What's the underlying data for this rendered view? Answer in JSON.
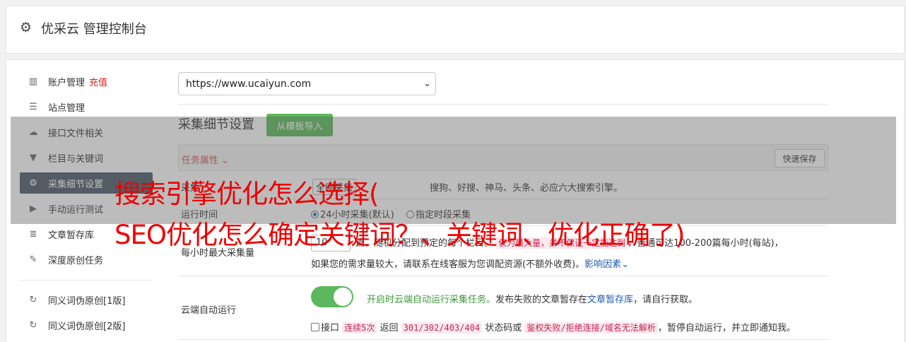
{
  "app": {
    "title": "优采云 管理控制台",
    "icon": "gear-icon"
  },
  "sidebar": {
    "items": [
      {
        "label": "账户管理",
        "extra": "充值",
        "icon": "bar-chart-icon",
        "glyph": "▥"
      },
      {
        "label": "站点管理",
        "icon": "server-icon",
        "glyph": "☰"
      },
      {
        "label": "接口文件相关",
        "icon": "cloud-upload-icon",
        "glyph": "☁"
      },
      {
        "label": "栏目与关键词",
        "icon": "filter-icon",
        "glyph": "▼"
      },
      {
        "label": "采集细节设置",
        "icon": "cogs-icon",
        "glyph": "⚙",
        "active": true
      },
      {
        "label": "手动运行测试",
        "icon": "play-circle-icon",
        "glyph": "▶"
      },
      {
        "label": "文章暂存库",
        "icon": "database-icon",
        "glyph": "≣"
      },
      {
        "label": "深度原创任务",
        "icon": "edit-icon",
        "glyph": "✎"
      },
      {
        "label": "同义词伪原创[1版]",
        "icon": "refresh-icon",
        "glyph": "↻"
      },
      {
        "label": "同义词伪原创[2版]",
        "icon": "refresh-icon",
        "glyph": "↻"
      }
    ]
  },
  "site_select": {
    "value": "https://www.ucaiyun.com"
  },
  "section": {
    "title": "采集细节设置",
    "template_button": "从模板导入"
  },
  "task_bar": {
    "label": "任务属性 ⌄",
    "quick_save": "快速保存"
  },
  "rows": {
    "engines": {
      "label_fragment": "采集",
      "box_text": "全网采集",
      "text": "搜狗、好搜、神马、头条、必应六大搜索引擎。"
    },
    "run_time": {
      "label": "运行时间",
      "option1": "24小时采集(默认)",
      "option2": "指定时段采集"
    },
    "max_per_hour": {
      "label": "每小时最大采集量",
      "value": "10",
      "text1": "篇，随机分配到预定的每个栏目。",
      "pink1": "仅为最大量，并不保证一定能达到",
      "text2": "，普通可达100-200篇每小时(每站)，",
      "text3": "如果您的需求量较大，请联系在线客服为您调配资源(不额外收费)。",
      "link": "影响因素"
    },
    "cloud_auto": {
      "label": "云端自动运行",
      "enabled": true,
      "green_text": "开启时云端自动运行采集任务。",
      "text1": "发布失败的文章暂存在",
      "link": "文章暂存库",
      "text2": "，请自行获取。",
      "cb_text": "接口",
      "pink1": "连续5次",
      "text3": "返回",
      "pink2": "301/302/403/404",
      "text4": "状态码或",
      "pink3": "鉴权失败/拒绝连接/域名无法解析",
      "text5": "，暂停自动运行，并立即通知我。"
    }
  },
  "watermark": {
    "line1": "搜索引擎优化怎么选择(",
    "line2": "SEO优化怎么确定关键词？、关键词、优化正确了)"
  },
  "colors": {
    "accent_green": "#5cb85c",
    "nav_active": "#4a5a6a",
    "warn_red": "#d9534f",
    "watermark": "#ee0000"
  }
}
